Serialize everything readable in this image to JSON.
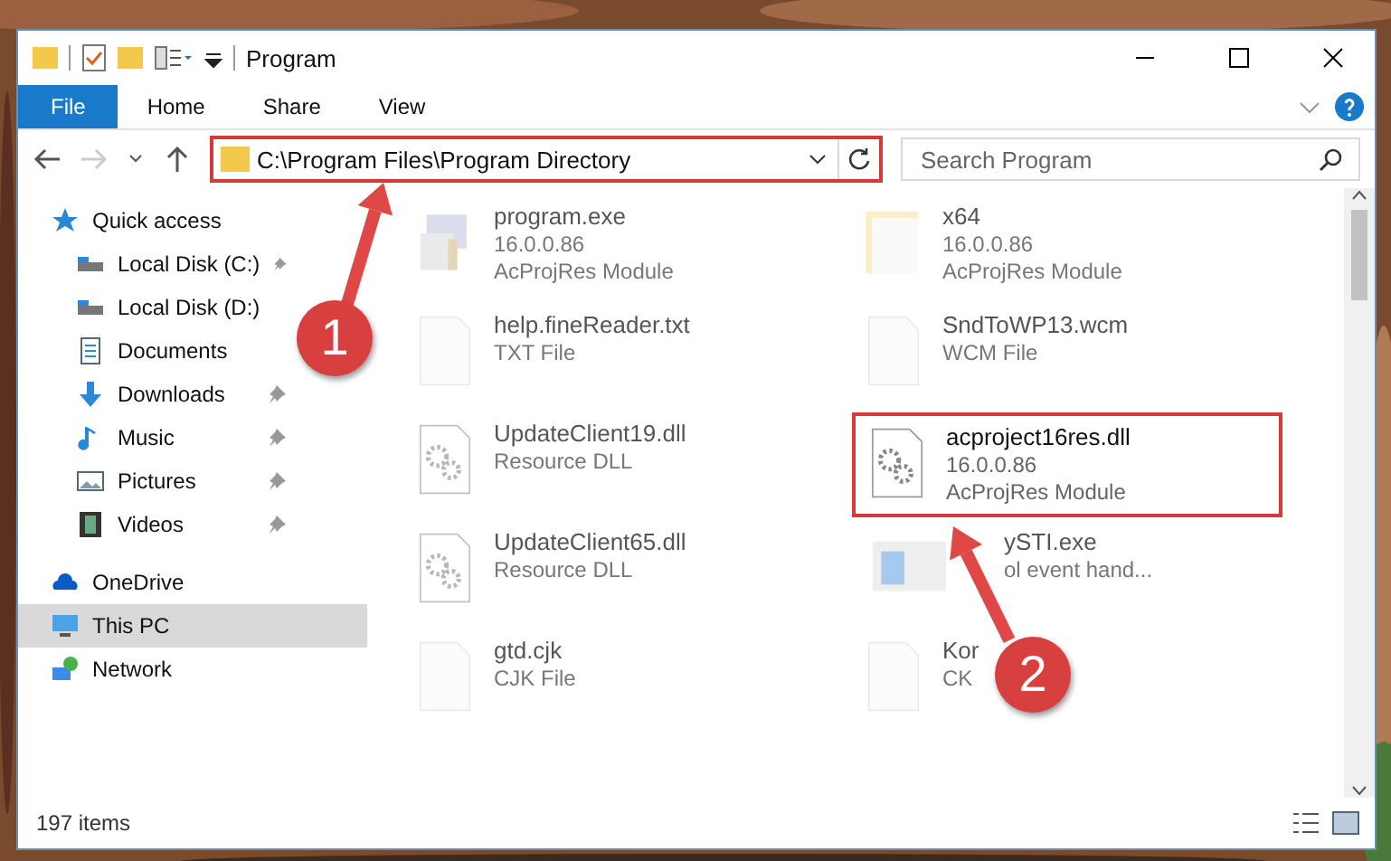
{
  "window": {
    "title": "Program"
  },
  "ribbon": {
    "tabs": [
      {
        "label": "File",
        "selected": true
      },
      {
        "label": "Home",
        "selected": false
      },
      {
        "label": "Share",
        "selected": false
      },
      {
        "label": "View",
        "selected": false
      }
    ]
  },
  "address": {
    "value": "C:\\Program Files\\Program Directory",
    "highlighted": true
  },
  "search": {
    "placeholder": "Search Program"
  },
  "sidebar": {
    "items": [
      {
        "label": "Quick access",
        "kind": "star",
        "selected": false,
        "children": [
          {
            "label": "Local Disk (C:)",
            "kind": "drive",
            "pinned": true,
            "selected": false
          },
          {
            "label": "Local Disk (D:)",
            "kind": "drive",
            "pinned": false,
            "selected": false
          },
          {
            "label": "Documents",
            "kind": "docs",
            "pinned": false,
            "selected": false
          },
          {
            "label": "Downloads",
            "kind": "download",
            "pinned": true,
            "selected": false
          },
          {
            "label": "Music",
            "kind": "music",
            "pinned": true,
            "selected": false
          },
          {
            "label": "Pictures",
            "kind": "pictures",
            "pinned": true,
            "selected": false
          },
          {
            "label": "Videos",
            "kind": "videos",
            "pinned": true,
            "selected": false
          }
        ]
      },
      {
        "label": "OneDrive",
        "kind": "cloud",
        "selected": false
      },
      {
        "label": "This PC",
        "kind": "pc",
        "selected": true
      },
      {
        "label": "Network",
        "kind": "network",
        "selected": false
      }
    ]
  },
  "files": [
    {
      "name": "program.exe",
      "details": [
        "16.0.0.86",
        "AcProjRes Module"
      ],
      "kind": "exe",
      "dimmed": true,
      "highlighted": false
    },
    {
      "name": "x64",
      "details": [
        "16.0.0.86",
        "AcProjRes Module"
      ],
      "kind": "folder",
      "dimmed": true,
      "highlighted": false
    },
    {
      "name": "help.fineReader.txt",
      "details": [
        "TXT File"
      ],
      "kind": "text",
      "dimmed": true,
      "highlighted": false
    },
    {
      "name": "SndToWP13.wcm",
      "details": [
        "WCM File"
      ],
      "kind": "text",
      "dimmed": true,
      "highlighted": false
    },
    {
      "name": "UpdateClient19.dll",
      "details": [
        "Resource DLL"
      ],
      "kind": "dll",
      "dimmed": true,
      "highlighted": false
    },
    {
      "name": "acproject16res.dll",
      "details": [
        "16.0.0.86",
        "AcProjRes Module"
      ],
      "kind": "dll",
      "dimmed": false,
      "highlighted": true
    },
    {
      "name": "UpdateClient65.dll",
      "details": [
        "Resource DLL"
      ],
      "kind": "dll",
      "dimmed": true,
      "highlighted": false
    },
    {
      "name": "ySTI.exe",
      "details": [
        "ol event hand..."
      ],
      "kind": "app",
      "dimmed": true,
      "highlighted": false
    },
    {
      "name": "gtd.cjk",
      "details": [
        "CJK File"
      ],
      "kind": "text",
      "dimmed": true,
      "highlighted": false
    },
    {
      "name": "Kor",
      "details": [
        "CK"
      ],
      "kind": "text",
      "dimmed": true,
      "highlighted": false
    }
  ],
  "status_bar": {
    "count": "197 items"
  },
  "callouts": [
    {
      "label": "1"
    },
    {
      "label": "2"
    }
  ]
}
